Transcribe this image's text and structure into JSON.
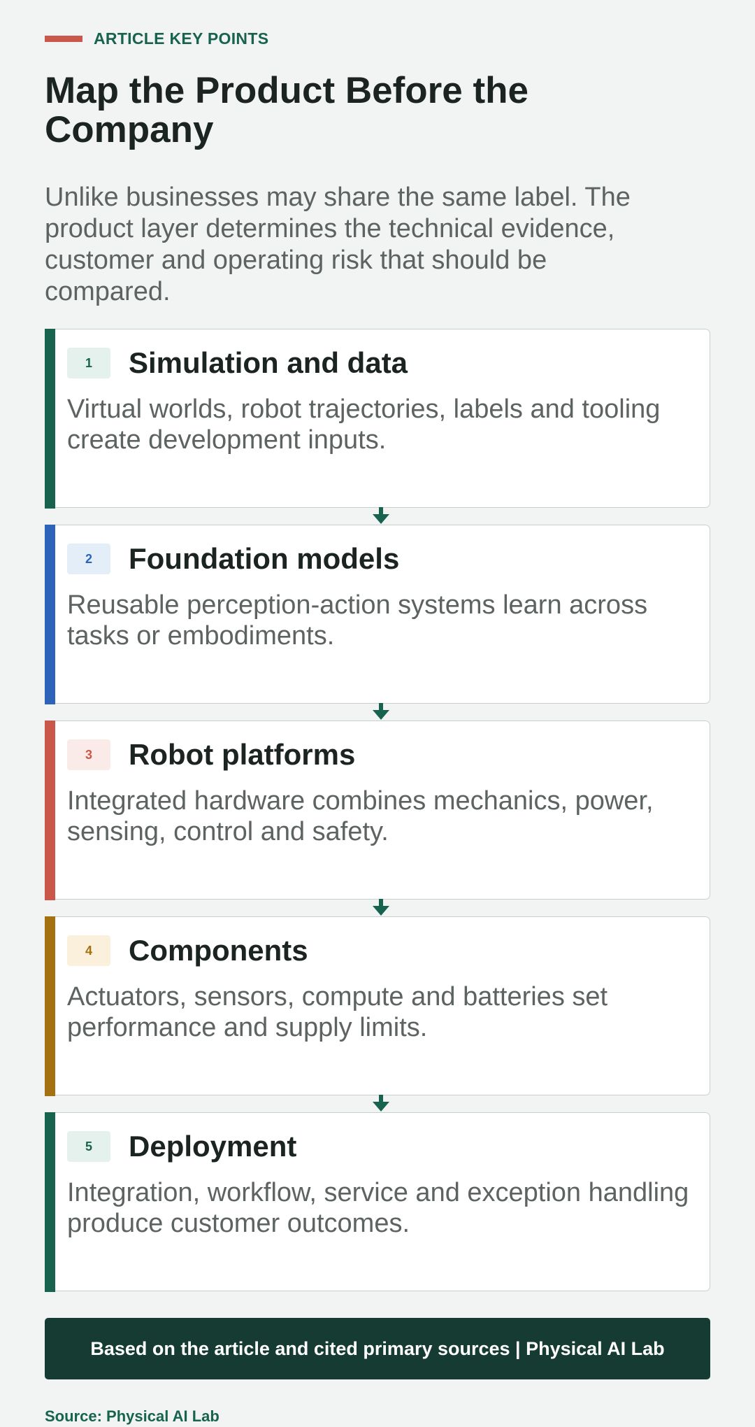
{
  "eyebrow": {
    "label": "ARTICLE KEY POINTS",
    "accent_color": "#c9574a"
  },
  "title": "Map the Product Before the Company",
  "subtitle": "Unlike businesses may share the same label. The product layer determines the technical evidence, customer and operating risk that should be compared.",
  "layers": [
    {
      "number": "1",
      "title": "Simulation and data",
      "description": "Virtual worlds, robot trajectories, labels and tooling create development inputs.",
      "accent_color": "#17634e",
      "badge_bg": "#e5f1ec",
      "badge_text_color": "#17634e"
    },
    {
      "number": "2",
      "title": "Foundation models",
      "description": "Reusable perception-action systems learn across tasks or embodiments.",
      "accent_color": "#2b64b8",
      "badge_bg": "#e4eef9",
      "badge_text_color": "#2b64b8"
    },
    {
      "number": "3",
      "title": "Robot platforms",
      "description": "Integrated hardware combines mechanics, power, sensing, control and safety.",
      "accent_color": "#c9574a",
      "badge_bg": "#fbebe8",
      "badge_text_color": "#c9574a"
    },
    {
      "number": "4",
      "title": "Components",
      "description": "Actuators, sensors, compute and batteries set performance and supply limits.",
      "accent_color": "#a5700f",
      "badge_bg": "#fbf0dc",
      "badge_text_color": "#a5700f"
    },
    {
      "number": "5",
      "title": "Deployment",
      "description": "Integration, workflow, service and exception handling produce customer outcomes.",
      "accent_color": "#17634e",
      "badge_bg": "#e5f1ec",
      "badge_text_color": "#17634e"
    }
  ],
  "connector_color": "#17634e",
  "footer": {
    "text": "Based on the article and cited primary sources | Physical AI Lab",
    "bg_color": "#153b32"
  },
  "source": "Source: Physical AI Lab"
}
